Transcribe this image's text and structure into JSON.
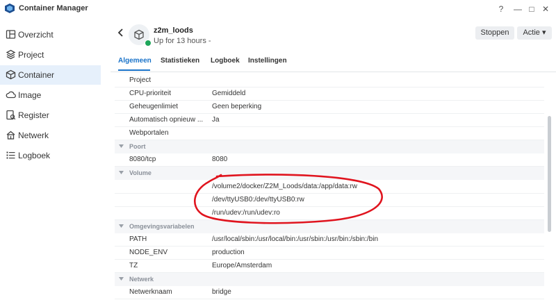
{
  "window": {
    "title": "Container Manager",
    "help": "?",
    "minimize": "—",
    "maximize": "□",
    "close": "✕"
  },
  "sidebar": {
    "items": [
      {
        "label": "Overzicht",
        "icon": "overview-icon"
      },
      {
        "label": "Project",
        "icon": "project-icon"
      },
      {
        "label": "Container",
        "icon": "container-icon",
        "active": true
      },
      {
        "label": "Image",
        "icon": "image-icon"
      },
      {
        "label": "Register",
        "icon": "registry-icon"
      },
      {
        "label": "Netwerk",
        "icon": "network-icon"
      },
      {
        "label": "Logboek",
        "icon": "log-icon"
      }
    ]
  },
  "header": {
    "name": "z2m_loods",
    "status": "Up for 13 hours -",
    "stop_label": "Stoppen",
    "action_label": "Actie ▾"
  },
  "tabs": [
    {
      "label": "Algemeen",
      "active": true
    },
    {
      "label": "Statistieken"
    },
    {
      "label": "Logboek"
    },
    {
      "label": "Instellingen"
    }
  ],
  "rows": [
    {
      "type": "field",
      "key": "Project",
      "value": ""
    },
    {
      "type": "field",
      "key": "CPU-prioriteit",
      "value": "Gemiddeld"
    },
    {
      "type": "field",
      "key": "Geheugenlimiet",
      "value": "Geen beperking"
    },
    {
      "type": "field",
      "key": "Automatisch opnieuw ...",
      "value": "Ja"
    },
    {
      "type": "field",
      "key": "Webportalen",
      "value": ""
    },
    {
      "type": "section",
      "label": "Poort"
    },
    {
      "type": "field",
      "key": "8080/tcp",
      "value": "8080"
    },
    {
      "type": "section",
      "label": "Volume"
    },
    {
      "type": "field",
      "key": "",
      "value": "/volume2/docker/Z2M_Loods/data:/app/data:rw"
    },
    {
      "type": "field",
      "key": "",
      "value": "/dev/ttyUSB0:/dev/ttyUSB0:rw"
    },
    {
      "type": "field",
      "key": "",
      "value": "/run/udev:/run/udev:ro"
    },
    {
      "type": "section",
      "label": "Omgevingsvariabelen"
    },
    {
      "type": "field",
      "key": "PATH",
      "value": "/usr/local/sbin:/usr/local/bin:/usr/sbin:/usr/bin:/sbin:/bin"
    },
    {
      "type": "field",
      "key": "NODE_ENV",
      "value": "production"
    },
    {
      "type": "field",
      "key": "TZ",
      "value": "Europe/Amsterdam"
    },
    {
      "type": "section",
      "label": "Netwerk"
    },
    {
      "type": "field",
      "key": "Netwerknaam",
      "value": "bridge"
    }
  ],
  "colors": {
    "accent": "#1a73c9",
    "status_running": "#1ea65a",
    "annotation": "#e0141e"
  }
}
